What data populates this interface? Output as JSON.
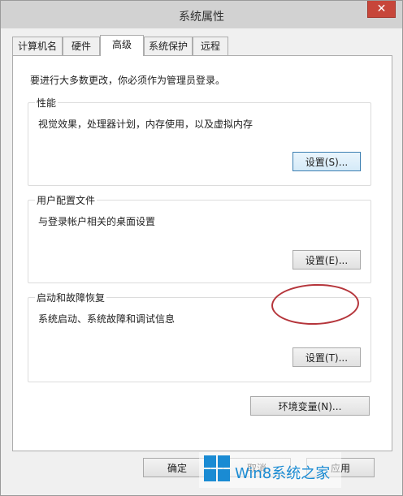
{
  "window": {
    "title": "系统属性",
    "close_glyph": "✕"
  },
  "tabs": [
    {
      "label": "计算机名"
    },
    {
      "label": "硬件"
    },
    {
      "label": "高级",
      "active": true
    },
    {
      "label": "系统保护"
    },
    {
      "label": "远程"
    }
  ],
  "intro": "要进行大多数更改，你必须作为管理员登录。",
  "groups": {
    "performance": {
      "title": "性能",
      "desc": "视觉效果，处理器计划，内存使用，以及虚拟内存",
      "button": "设置(S)..."
    },
    "profiles": {
      "title": "用户配置文件",
      "desc": "与登录帐户相关的桌面设置",
      "button": "设置(E)..."
    },
    "startup": {
      "title": "启动和故障恢复",
      "desc": "系统启动、系统故障和调试信息",
      "button": "设置(T)..."
    }
  },
  "env_button": "环境变量(N)...",
  "footer": {
    "ok": "确定",
    "cancel": "取消",
    "apply": "应用"
  },
  "watermark": {
    "text": "Win8系统之家"
  },
  "colors": {
    "accent": "#1a8bd3",
    "close": "#c7463a",
    "annotation": "#b5353b"
  }
}
